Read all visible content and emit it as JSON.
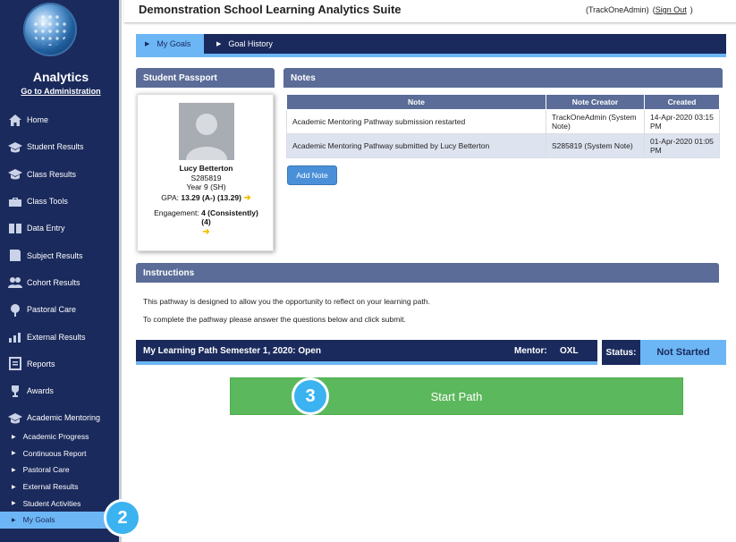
{
  "sidebar": {
    "app_title": "Analytics",
    "admin_link": "Go to Administration",
    "items": [
      {
        "label": "Home",
        "icon": "home-icon"
      },
      {
        "label": "Student Results",
        "icon": "graduation-cap-icon"
      },
      {
        "label": "Class Results",
        "icon": "graduation-cap-icon"
      },
      {
        "label": "Class Tools",
        "icon": "toolbox-icon"
      },
      {
        "label": "Data Entry",
        "icon": "book-icon"
      },
      {
        "label": "Subject Results",
        "icon": "book-icon"
      },
      {
        "label": "Cohort Results",
        "icon": "users-icon"
      },
      {
        "label": "Pastoral Care",
        "icon": "tree-icon"
      },
      {
        "label": "External Results",
        "icon": "bar-chart-icon"
      },
      {
        "label": "Reports",
        "icon": "report-icon"
      },
      {
        "label": "Awards",
        "icon": "trophy-icon"
      },
      {
        "label": "Academic Mentoring",
        "icon": "graduation-cap-icon"
      }
    ],
    "subitems": [
      {
        "label": "Academic Progress"
      },
      {
        "label": "Continuous Report"
      },
      {
        "label": "Pastoral Care"
      },
      {
        "label": "External Results"
      },
      {
        "label": "Student Activities"
      },
      {
        "label": "My Goals"
      }
    ]
  },
  "header": {
    "title": "Demonstration School Learning Analytics Suite",
    "user": "(TrackOneAdmin)",
    "signout": "Sign Out"
  },
  "tabs": [
    {
      "label": "My Goals"
    },
    {
      "label": "Goal History"
    }
  ],
  "passport": {
    "heading": "Student Passport",
    "name": "Lucy Betterton",
    "id": "S285819",
    "year": "Year 9 (SH)",
    "gpa_label": "GPA:",
    "gpa_value": "13.29 (A-) (13.29)",
    "engagement_label": "Engagement:",
    "engagement_value": "4 (Consistently)",
    "engagement_extra": "(4)"
  },
  "notes": {
    "heading": "Notes",
    "columns": [
      "Note",
      "Note Creator",
      "Created"
    ],
    "rows": [
      {
        "note": "Academic Mentoring Pathway submission restarted",
        "creator": "TrackOneAdmin (System Note)",
        "created": "14-Apr-2020 03:15 PM"
      },
      {
        "note": "Academic Mentoring Pathway submitted by Lucy Betterton",
        "creator": "S285819 (System Note)",
        "created": "01-Apr-2020 01:05 PM"
      }
    ],
    "add_label": "Add Note"
  },
  "instructions": {
    "heading": "Instructions",
    "line1": "This pathway is designed to allow you the opportunity to reflect on your learning path.",
    "line2": "To complete the pathway please answer the questions below and click submit."
  },
  "path": {
    "title": "My Learning Path Semester 1, 2020:  Open",
    "mentor_label": "Mentor:",
    "mentor_value": "OXL",
    "status_label": "Status:",
    "status_value": "Not Started",
    "start_label": "Start Path"
  },
  "badges": {
    "sidebar": "2",
    "start": "3"
  }
}
